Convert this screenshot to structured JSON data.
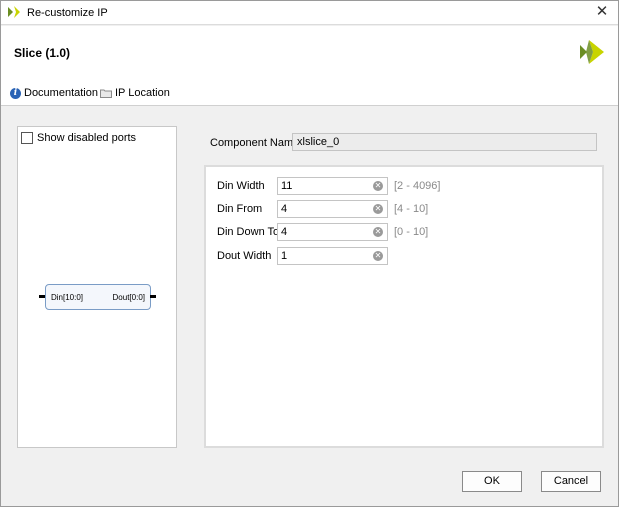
{
  "window": {
    "title": "Re-customize IP",
    "close_glyph": "✕"
  },
  "header": {
    "ip_name": "Slice (1.0)",
    "brand_colors": [
      "#6b8e23",
      "#c8d400"
    ]
  },
  "links": [
    {
      "label": "Documentation",
      "icon": "info-icon"
    },
    {
      "label": "IP Location",
      "icon": "folder-icon"
    }
  ],
  "symbol": {
    "show_disabled_ports_label": "Show disabled ports",
    "show_disabled_ports_checked": false,
    "input_port": "Din[10:0]",
    "output_port": "Dout[0:0]"
  },
  "component": {
    "label": "Component Name",
    "value": "xlslice_0"
  },
  "params": [
    {
      "label": "Din Width",
      "value": "11",
      "range": "[2 - 4096]"
    },
    {
      "label": "Din From",
      "value": "4",
      "range": "[4 - 10]"
    },
    {
      "label": "Din Down To",
      "value": "4",
      "range": "[0 - 10]"
    },
    {
      "label": "Dout Width",
      "value": "1",
      "range": ""
    }
  ],
  "buttons": {
    "ok": "OK",
    "cancel": "Cancel"
  }
}
